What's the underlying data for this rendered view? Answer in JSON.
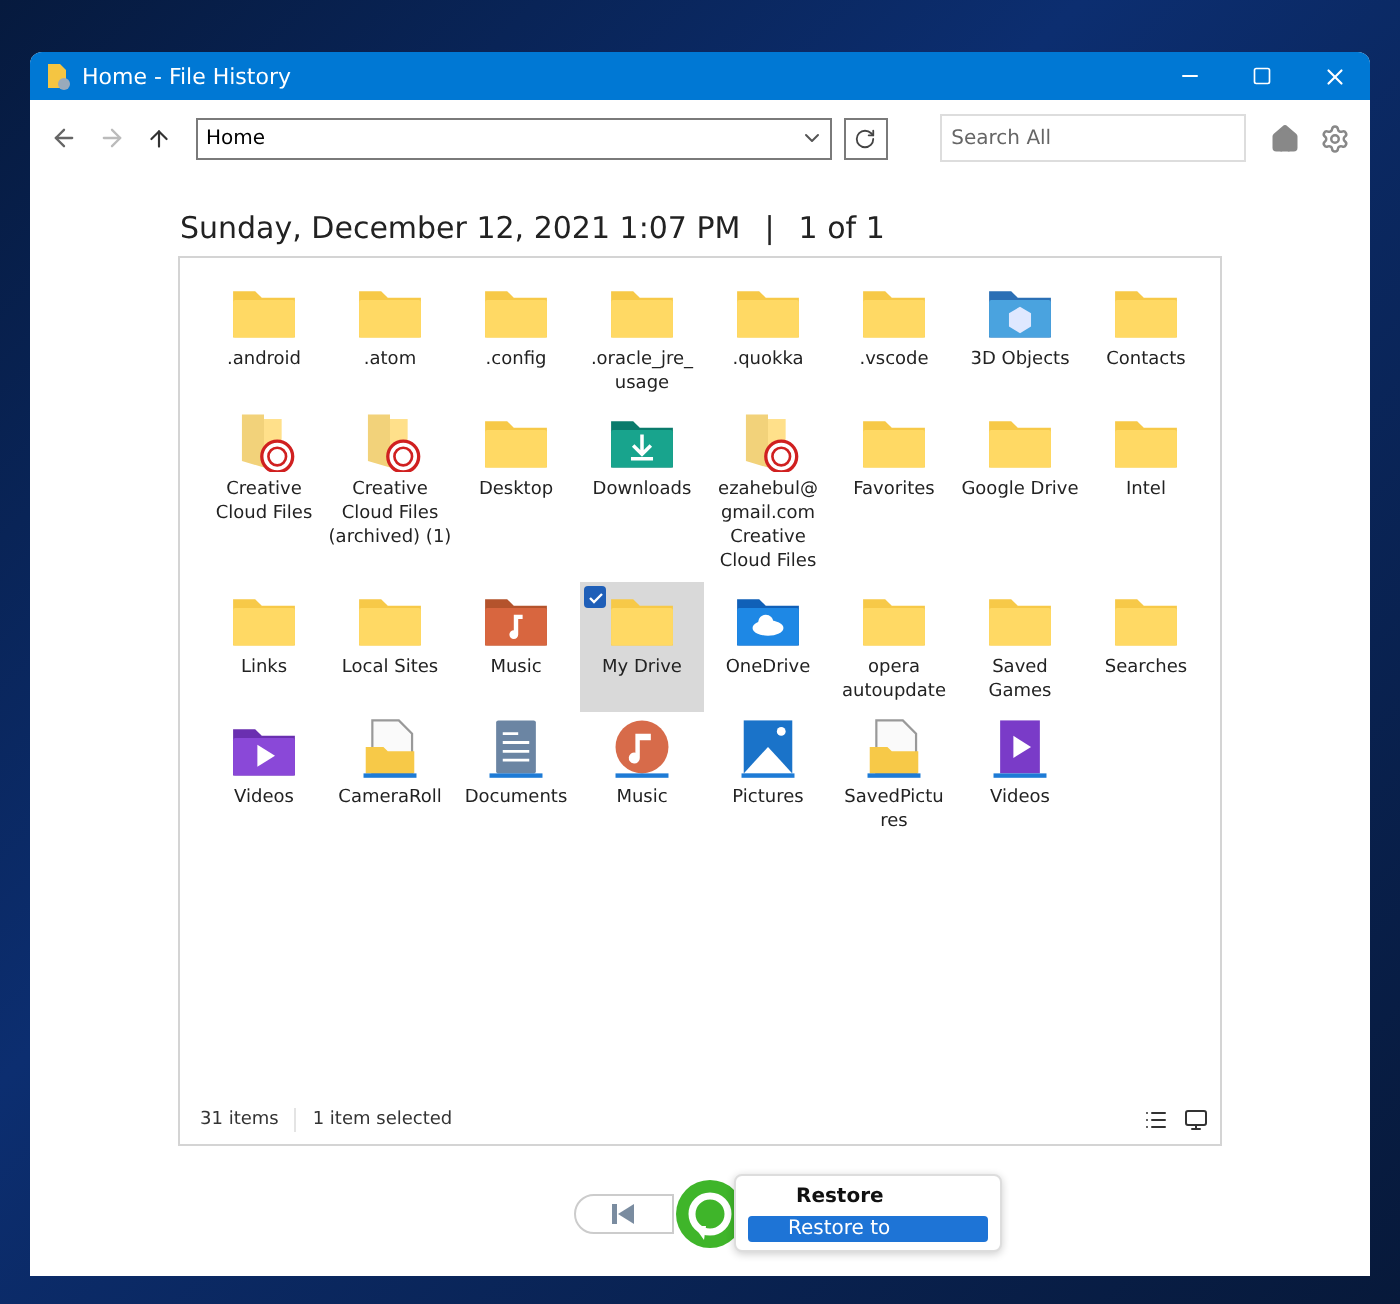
{
  "window": {
    "title": "Home - File History"
  },
  "toolbar": {
    "address": "Home",
    "search": {
      "placeholder": "Search All"
    }
  },
  "heading": {
    "date": "Sunday, December 12, 2021 1:07 PM",
    "separator": "|",
    "page": "1 of 1"
  },
  "items": [
    {
      "label": ".android",
      "kind": "folder",
      "selected": false
    },
    {
      "label": ".atom",
      "kind": "folder",
      "selected": false
    },
    {
      "label": ".config",
      "kind": "folder",
      "selected": false
    },
    {
      "label": ".oracle_jre_ usage",
      "kind": "folder",
      "selected": false
    },
    {
      "label": ".quokka",
      "kind": "folder",
      "selected": false
    },
    {
      "label": ".vscode",
      "kind": "folder",
      "selected": false
    },
    {
      "label": "3D Objects",
      "kind": "objects",
      "selected": false
    },
    {
      "label": "Contacts",
      "kind": "folder",
      "selected": false
    },
    {
      "label": "Creative Cloud Files",
      "kind": "cloud",
      "selected": false
    },
    {
      "label": "Creative Cloud Files (archived) (1)",
      "kind": "cloud",
      "selected": false
    },
    {
      "label": "Desktop",
      "kind": "folder",
      "selected": false
    },
    {
      "label": "Downloads",
      "kind": "downloads",
      "selected": false
    },
    {
      "label": "ezahebul@ gmail.com Creative Cloud Files",
      "kind": "cloud",
      "selected": false
    },
    {
      "label": "Favorites",
      "kind": "folder",
      "selected": false
    },
    {
      "label": "Google Drive",
      "kind": "folder",
      "selected": false
    },
    {
      "label": "Intel",
      "kind": "folder",
      "selected": false
    },
    {
      "label": "Links",
      "kind": "folder",
      "selected": false
    },
    {
      "label": "Local Sites",
      "kind": "folder",
      "selected": false
    },
    {
      "label": "Music",
      "kind": "musicfolder",
      "selected": false
    },
    {
      "label": "My Drive",
      "kind": "folder",
      "selected": true
    },
    {
      "label": "OneDrive",
      "kind": "onedrive",
      "selected": false
    },
    {
      "label": "opera autoupdate",
      "kind": "folder",
      "selected": false
    },
    {
      "label": "Saved Games",
      "kind": "folder",
      "selected": false
    },
    {
      "label": "Searches",
      "kind": "folder",
      "selected": false
    },
    {
      "label": "Videos",
      "kind": "videofolder",
      "selected": false
    },
    {
      "label": "CameraRoll",
      "kind": "library",
      "selected": false
    },
    {
      "label": "Documents",
      "kind": "documents",
      "selected": false
    },
    {
      "label": "Music",
      "kind": "music",
      "selected": false
    },
    {
      "label": "Pictures",
      "kind": "pictures",
      "selected": false
    },
    {
      "label": "SavedPictu res",
      "kind": "library",
      "selected": false
    },
    {
      "label": "Videos",
      "kind": "videos",
      "selected": false
    }
  ],
  "status_bar": {
    "count": "31 items",
    "selection": "1 item selected"
  },
  "menu": [
    {
      "label": "Restore",
      "selected": false
    },
    {
      "label": "Restore to",
      "selected": true
    }
  ]
}
